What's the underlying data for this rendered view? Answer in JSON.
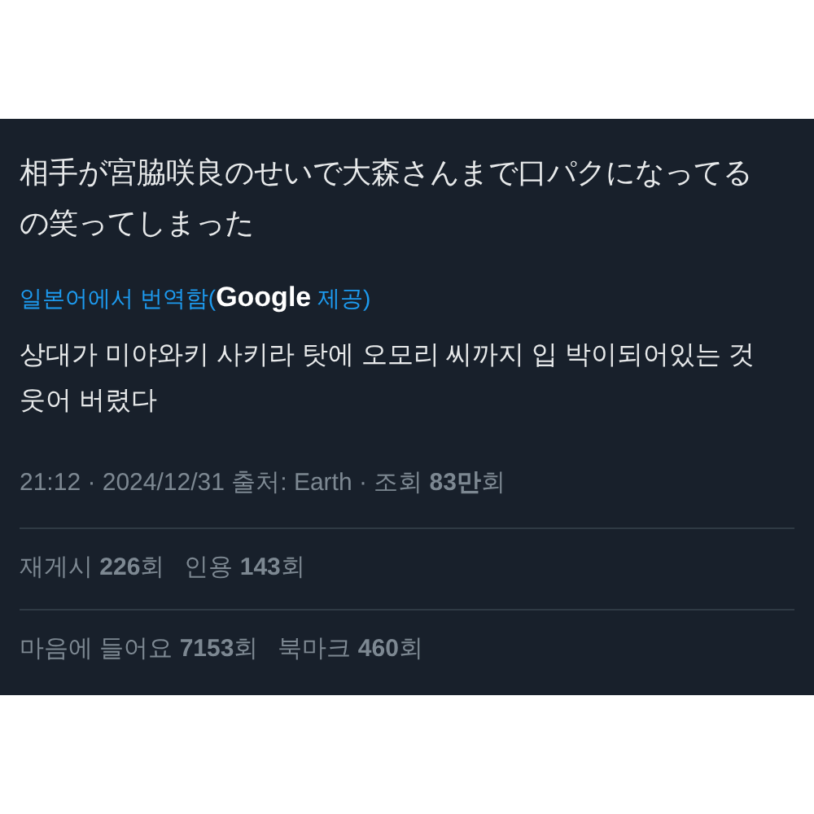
{
  "tweet": {
    "text": "相手が宮脇咲良のせいで大森さんまで口パクになってるの笑ってしまった",
    "translation_note": {
      "prefix": "일본어에서 번역함(",
      "brand": "Google",
      "suffix": " 제공)"
    },
    "translated_text": "상대가 미야와키 사키라 탓에 오모리 씨까지 입 박이되어있는 것 웃어 버렸다",
    "meta": "21:12 · 2024/12/31 출처: Earth · 조회 **83만**회",
    "stat_rows": [
      [
        "재게시 **226**회",
        "인용 **143**회"
      ],
      [
        "마음에 들어요 **7153**회",
        "북마크 **460**회"
      ]
    ]
  }
}
